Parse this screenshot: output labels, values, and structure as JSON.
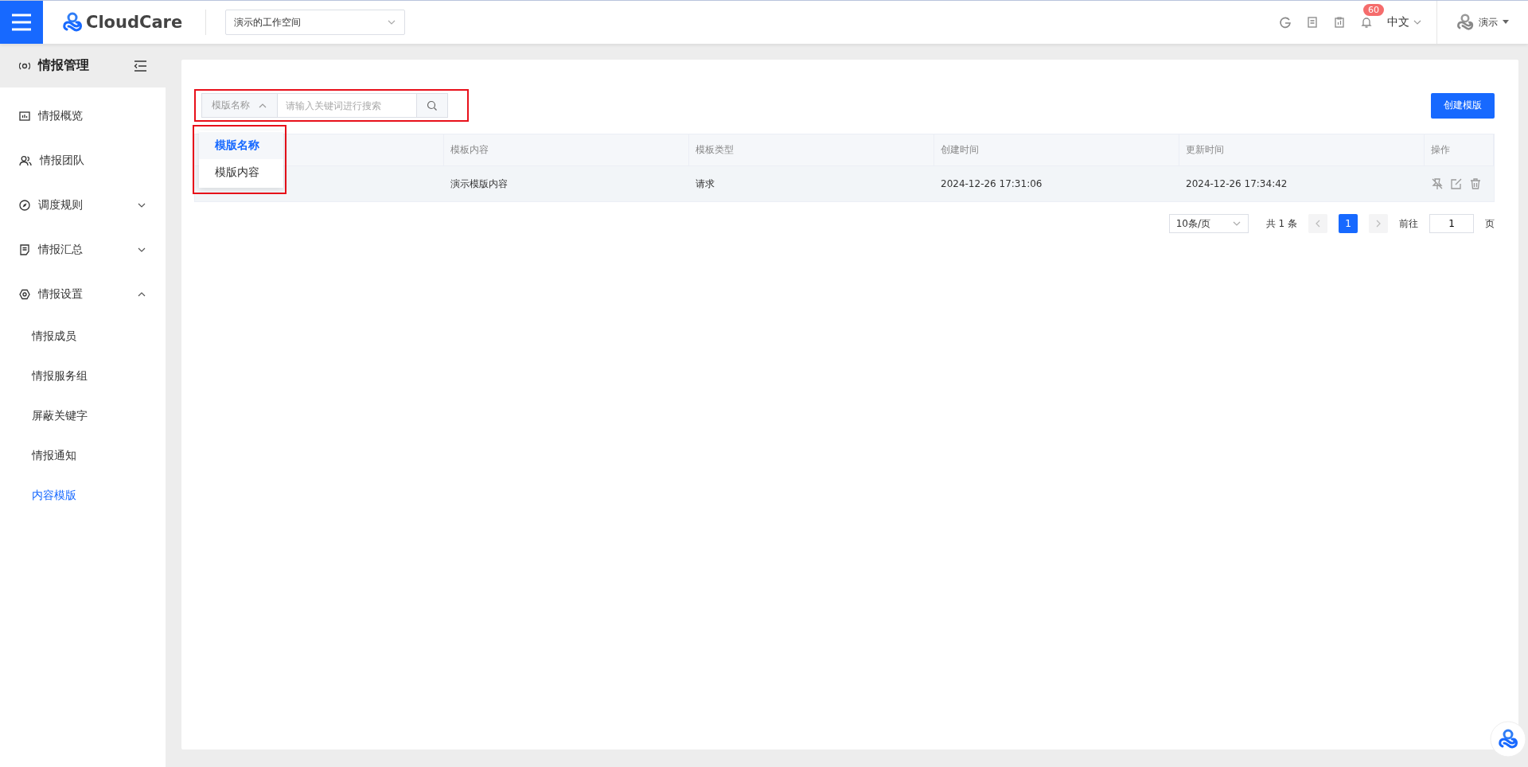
{
  "header": {
    "logo": "CloudCare",
    "workspace": "演示的工作空间",
    "notifications": "60",
    "language": "中文",
    "user": "演示"
  },
  "sidebar": {
    "title": "情报管理",
    "items": [
      {
        "label": "情报概览",
        "selected": false
      },
      {
        "label": "情报团队",
        "selected": false
      },
      {
        "label": "调度规则",
        "expanded": false,
        "selected": false
      },
      {
        "label": "情报汇总",
        "expanded": false,
        "selected": false
      },
      {
        "label": "情报设置",
        "expanded": true,
        "selected": false,
        "children": [
          {
            "label": "情报成员",
            "selected": false
          },
          {
            "label": "情报服务组",
            "selected": false
          },
          {
            "label": "屏蔽关键字",
            "selected": false
          },
          {
            "label": "情报通知",
            "selected": false
          },
          {
            "label": "内容模版",
            "selected": true
          }
        ]
      }
    ]
  },
  "search": {
    "field_selector": "模版名称",
    "placeholder": "请输入关键词进行搜索",
    "dropdown": [
      {
        "label": "模版名称",
        "selected": true
      },
      {
        "label": "模版内容",
        "selected": false
      }
    ]
  },
  "create_button": "创建模版",
  "table": {
    "columns": [
      "模板内容",
      "模板类型",
      "创建时间",
      "更新时间",
      "操作"
    ],
    "rows": [
      {
        "cells": [
          "演示模版内容",
          "请求",
          "2024-12-26 17:31:06",
          "2024-12-26 17:34:42"
        ]
      }
    ]
  },
  "pagination": {
    "page_size": "10条/页",
    "total": "共 1 条",
    "pages": [
      {
        "label": "1",
        "selected": true
      }
    ],
    "goto_label": "前往",
    "goto_value": "1",
    "page_suffix": "页"
  }
}
